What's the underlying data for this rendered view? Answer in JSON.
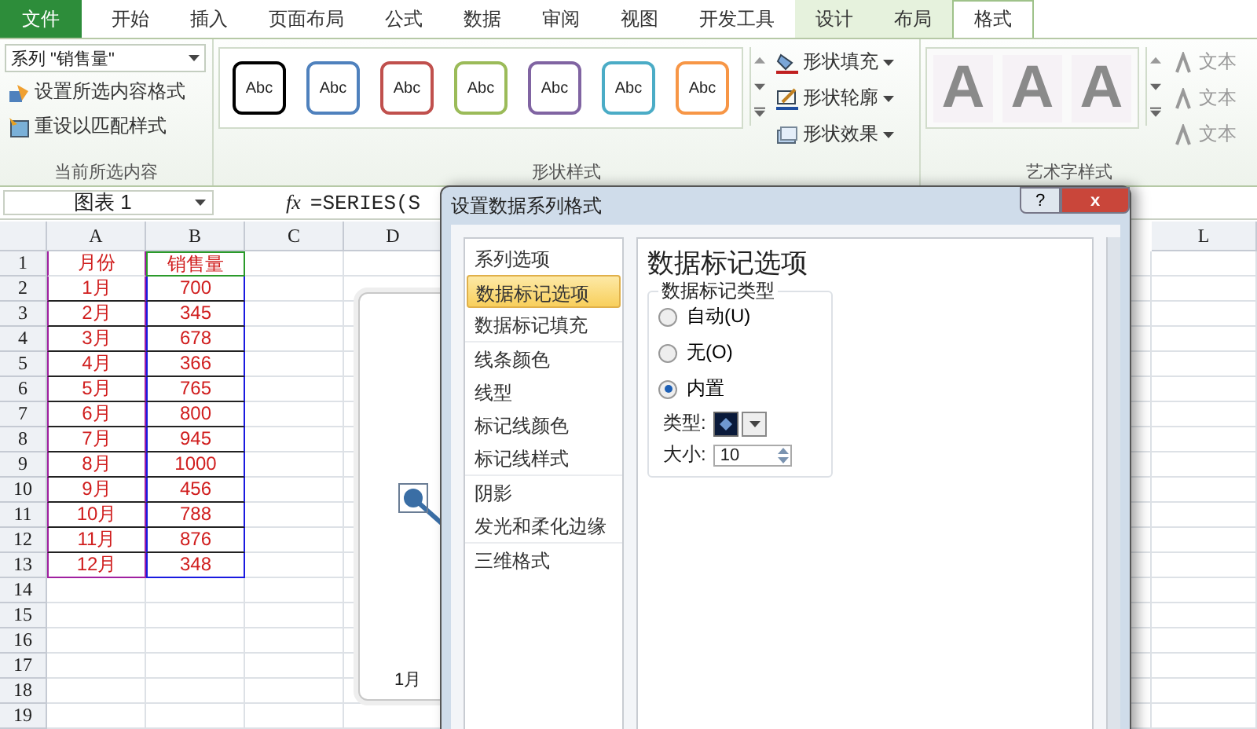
{
  "ribbon_tabs": [
    {
      "label": "文件",
      "kind": "file",
      "selected": false
    },
    {
      "label": "开始",
      "kind": "normal",
      "selected": false
    },
    {
      "label": "插入",
      "kind": "normal",
      "selected": false
    },
    {
      "label": "页面布局",
      "kind": "normal",
      "selected": false
    },
    {
      "label": "公式",
      "kind": "normal",
      "selected": false
    },
    {
      "label": "数据",
      "kind": "normal",
      "selected": false
    },
    {
      "label": "审阅",
      "kind": "normal",
      "selected": false
    },
    {
      "label": "视图",
      "kind": "normal",
      "selected": false
    },
    {
      "label": "开发工具",
      "kind": "normal",
      "selected": false
    },
    {
      "label": "设计",
      "kind": "contextual",
      "selected": false
    },
    {
      "label": "布局",
      "kind": "contextual",
      "selected": false
    },
    {
      "label": "格式",
      "kind": "contextual",
      "selected": true
    }
  ],
  "current_selection": {
    "dropdown": "系列 \"销售量\"",
    "buttons": [
      "设置所选内容格式",
      "重设以匹配样式"
    ],
    "label": "当前所选内容"
  },
  "shape_styles": {
    "gallery": [
      {
        "text": "Abc",
        "color": "#000000"
      },
      {
        "text": "Abc",
        "color": "#4f81bd"
      },
      {
        "text": "Abc",
        "color": "#c0504d"
      },
      {
        "text": "Abc",
        "color": "#9bbb59"
      },
      {
        "text": "Abc",
        "color": "#8064a2"
      },
      {
        "text": "Abc",
        "color": "#4bacc6"
      },
      {
        "text": "Abc",
        "color": "#f79646"
      }
    ],
    "buttons": [
      "形状填充",
      "形状轮廓",
      "形状效果"
    ],
    "label": "形状样式"
  },
  "wordart_styles": {
    "gallery": [
      "A",
      "A",
      "A"
    ],
    "buttons": [
      "文本",
      "文本",
      "文本"
    ],
    "label": "艺术字样式"
  },
  "formula_bar": {
    "name_box": "图表 1",
    "fx": "fx",
    "formula": "=SERIES(S"
  },
  "sheet": {
    "columns": [
      "A",
      "B",
      "C",
      "D",
      "L"
    ],
    "rows": [
      {
        "num": "1",
        "a": "月份",
        "b": "销售量"
      },
      {
        "num": "2",
        "a": "1月",
        "b": "700"
      },
      {
        "num": "3",
        "a": "2月",
        "b": "345"
      },
      {
        "num": "4",
        "a": "3月",
        "b": "678"
      },
      {
        "num": "5",
        "a": "4月",
        "b": "366"
      },
      {
        "num": "6",
        "a": "5月",
        "b": "765"
      },
      {
        "num": "7",
        "a": "6月",
        "b": "800"
      },
      {
        "num": "8",
        "a": "7月",
        "b": "945"
      },
      {
        "num": "9",
        "a": "8月",
        "b": "1000"
      },
      {
        "num": "10",
        "a": "9月",
        "b": "456"
      },
      {
        "num": "11",
        "a": "10月",
        "b": "788"
      },
      {
        "num": "12",
        "a": "11月",
        "b": "876"
      },
      {
        "num": "13",
        "a": "12月",
        "b": "348"
      },
      {
        "num": "14"
      },
      {
        "num": "15"
      },
      {
        "num": "16"
      },
      {
        "num": "17"
      },
      {
        "num": "18"
      },
      {
        "num": "19"
      }
    ]
  },
  "chart": {
    "axis_label": "1月"
  },
  "dialog": {
    "title": "设置数据系列格式",
    "help": "?",
    "close": "x",
    "nav_groups": [
      {
        "items": [
          {
            "label": "系列选项",
            "selected": false
          },
          {
            "label": "数据标记选项",
            "selected": true
          },
          {
            "label": "数据标记填充",
            "selected": false
          }
        ]
      },
      {
        "items": [
          {
            "label": "线条颜色",
            "selected": false
          },
          {
            "label": "线型",
            "selected": false
          },
          {
            "label": "标记线颜色",
            "selected": false
          },
          {
            "label": "标记线样式",
            "selected": false
          }
        ]
      },
      {
        "items": [
          {
            "label": "阴影",
            "selected": false
          },
          {
            "label": "发光和柔化边缘",
            "selected": false
          }
        ]
      },
      {
        "items": [
          {
            "label": "三维格式",
            "selected": false
          }
        ]
      }
    ],
    "heading": "数据标记选项",
    "group_title": "数据标记类型",
    "radios": [
      {
        "label": "自动(U)",
        "selected": false
      },
      {
        "label": "无(O)",
        "selected": false
      },
      {
        "label": "内置",
        "selected": true
      }
    ],
    "type_label": "类型:",
    "size_label": "大小:",
    "size_value": "10"
  }
}
